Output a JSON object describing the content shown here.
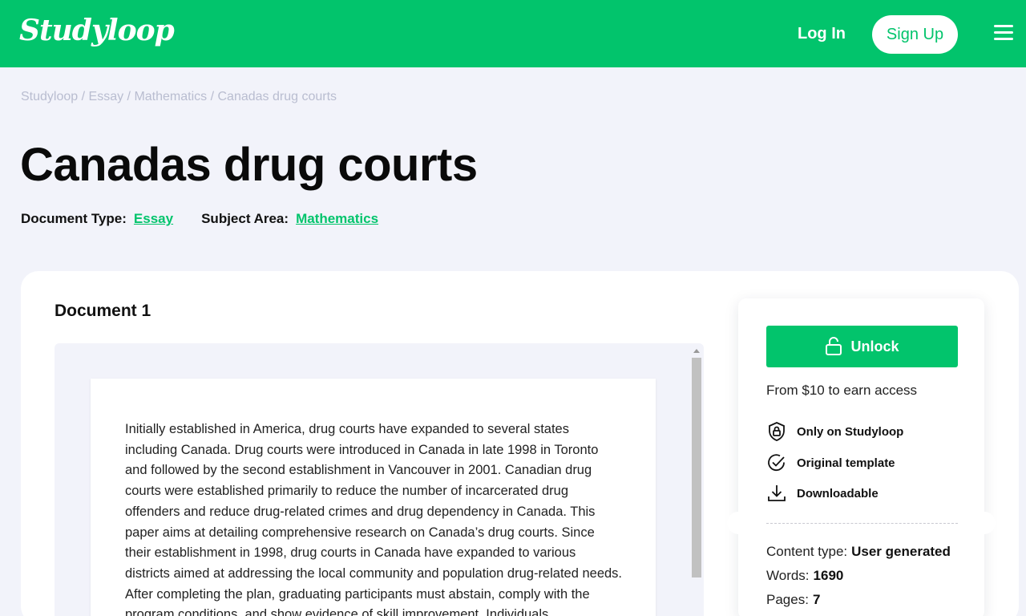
{
  "header": {
    "logo_text": "Studyloop",
    "login_label": "Log In",
    "signup_label": "Sign Up",
    "menu_icon": "hamburger-menu-icon",
    "background_color": "#02c46c"
  },
  "breadcrumb": {
    "items": [
      "Studyloop",
      "Essay",
      "Mathematics",
      "Canadas drug courts"
    ],
    "separator": "/"
  },
  "page_title": "Canadas drug courts",
  "meta": {
    "document_type_label": "Document Type:",
    "document_type_value": "Essay",
    "subject_area_label": "Subject Area:",
    "subject_area_value": "Mathematics"
  },
  "document": {
    "heading": "Document 1",
    "text": "Initially established in America, drug courts have expanded to several states including Canada. Drug courts were introduced in Canada in late 1998 in Toronto and followed by the second establishment in Vancouver in 2001. Canadian drug courts were established primarily to reduce the number of incarcerated drug offenders and reduce drug-related crimes and drug dependency in Canada. This paper aims at detailing comprehensive research on Canada’s drug courts. Since their establishment in 1998, drug courts in Canada have expanded to various districts aimed at addressing the local community and population drug-related needs. After completing the plan, graduating participants must abstain, comply with the program conditions, and show evidence of skill improvement. Individuals"
  },
  "sidebar": {
    "unlock_label": "Unlock",
    "price_text": "From $10 to earn access",
    "features": [
      {
        "icon": "shield-lock-icon",
        "label": "Only on Studyloop"
      },
      {
        "icon": "check-circle-icon",
        "label": "Original template"
      },
      {
        "icon": "download-icon",
        "label": "Downloadable"
      }
    ],
    "info": {
      "content_type_label": "Content type:",
      "content_type_value": "User generated",
      "words_label": "Words:",
      "words_value": "1690",
      "pages_label": "Pages:",
      "pages_value": "7"
    },
    "accent_color": "#02c46c"
  }
}
